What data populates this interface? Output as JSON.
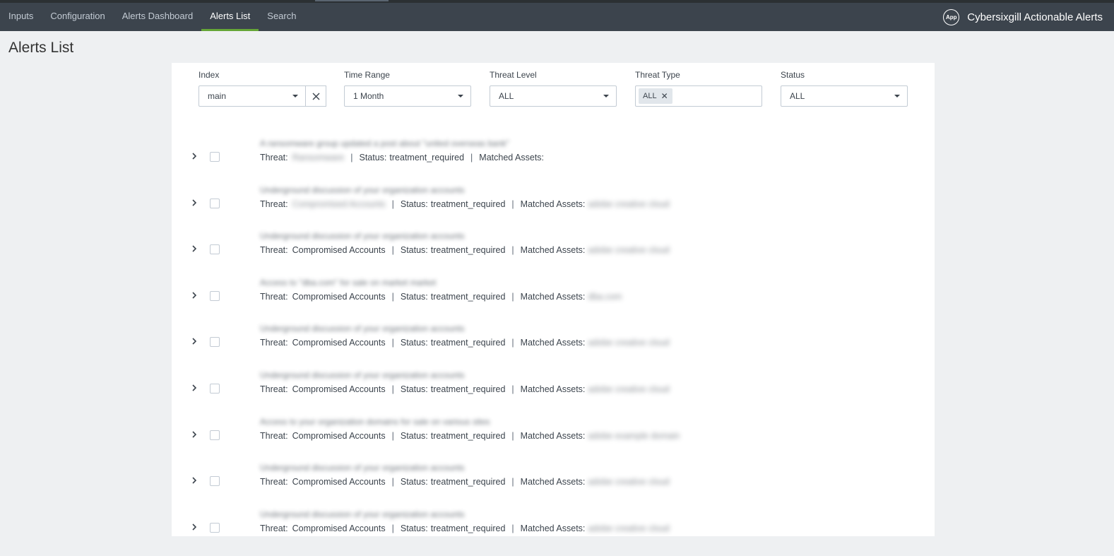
{
  "nav": {
    "items": [
      {
        "label": "Inputs"
      },
      {
        "label": "Configuration"
      },
      {
        "label": "Alerts Dashboard"
      },
      {
        "label": "Alerts List",
        "active": true
      },
      {
        "label": "Search"
      }
    ],
    "app_badge": "App",
    "app_title": "Cybersixgill Actionable Alerts",
    "accent_color": "#65a637"
  },
  "page": {
    "title": "Alerts List"
  },
  "filters": {
    "index": {
      "label": "Index",
      "value": "main"
    },
    "time_range": {
      "label": "Time Range",
      "value": "1 Month"
    },
    "threat_level": {
      "label": "Threat Level",
      "value": "ALL"
    },
    "threat_type": {
      "label": "Threat Type",
      "chip": "ALL"
    },
    "status": {
      "label": "Status",
      "value": "ALL"
    }
  },
  "labels": {
    "threat": "Threat:",
    "status": "Status:",
    "matched_assets": "Matched Assets:"
  },
  "alerts": [
    {
      "title": "A ransomware group updated a post about \"united overseas bank\"",
      "threat": "Ransomware",
      "status": "treatment_required",
      "assets": ""
    },
    {
      "title": "Underground discussion of your organization accounts",
      "threat": "Compromised Accounts",
      "status": "treatment_required",
      "assets": "adobe creative cloud"
    },
    {
      "title": "Underground discussion of your organization accounts",
      "threat": "Compromised Accounts",
      "status": "treatment_required",
      "assets": "adobe creative cloud"
    },
    {
      "title": "Access to \"dba.com\" for sale on market market",
      "threat": "Compromised Accounts",
      "status": "treatment_required",
      "assets": "dba.com"
    },
    {
      "title": "Underground discussion of your organization accounts",
      "threat": "Compromised Accounts",
      "status": "treatment_required",
      "assets": "adobe creative cloud"
    },
    {
      "title": "Underground discussion of your organization accounts",
      "threat": "Compromised Accounts",
      "status": "treatment_required",
      "assets": "adobe creative cloud"
    },
    {
      "title": "Access to your organization domains for sale on various sites",
      "threat": "Compromised Accounts",
      "status": "treatment_required",
      "assets": "adobe example domain"
    },
    {
      "title": "Underground discussion of your organization accounts",
      "threat": "Compromised Accounts",
      "status": "treatment_required",
      "assets": "adobe creative cloud"
    },
    {
      "title": "Underground discussion of your organization accounts",
      "threat": "Compromised Accounts",
      "status": "treatment_required",
      "assets": "adobe creative cloud"
    }
  ]
}
